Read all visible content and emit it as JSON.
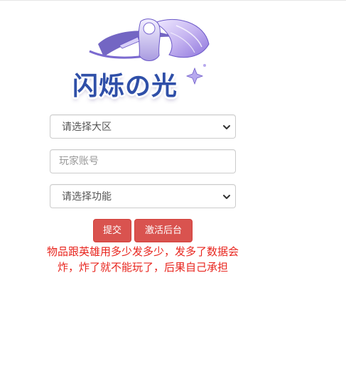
{
  "logo": {
    "text": "闪烁の光",
    "colors": {
      "primary": "#2f4fa8",
      "wing": "#b9a6ec",
      "accent": "#7a5fd6"
    }
  },
  "form": {
    "region_select": {
      "selected": "请选择大区",
      "icon": "chevron-down-icon"
    },
    "account_input": {
      "value": "",
      "placeholder": "玩家账号"
    },
    "function_select": {
      "selected": "请选择功能",
      "icon": "chevron-down-icon"
    },
    "buttons": {
      "submit_label": "提交",
      "activate_label": "激活后台",
      "color": "#d9534f"
    }
  },
  "warning": {
    "text": "物品跟英雄用多少发多少，发多了数据会炸，炸了就不能玩了，后果自己承担",
    "color": "#e8251e"
  }
}
